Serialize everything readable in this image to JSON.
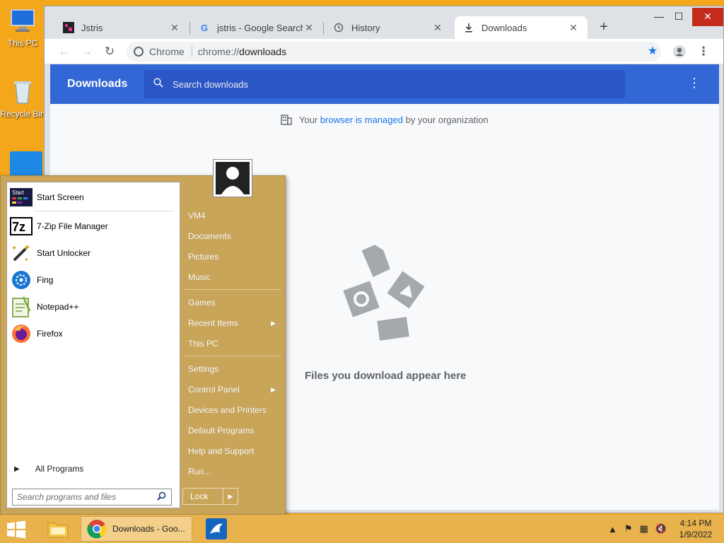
{
  "desktop": {
    "icons": [
      {
        "label": "This PC"
      },
      {
        "label": "Recycle Bin"
      }
    ]
  },
  "browser": {
    "tabs": [
      {
        "title": "Jstris",
        "icon": "jstris-icon"
      },
      {
        "title": "jstris - Google Search",
        "icon": "google-icon"
      },
      {
        "title": "History",
        "icon": "history-icon"
      },
      {
        "title": "Downloads",
        "icon": "download-icon",
        "active": true
      }
    ],
    "omnibox": {
      "chip": "Chrome",
      "url_scheme": "chrome://",
      "url_host": "downloads"
    }
  },
  "downloads_page": {
    "title": "Downloads",
    "search_placeholder": "Search downloads",
    "managed": {
      "prefix": "Your ",
      "link": "browser is managed",
      "suffix": " by your organization"
    },
    "empty_text": "Files you download appear here"
  },
  "start_menu": {
    "pinned": [
      {
        "label": "Start Screen"
      },
      {
        "label": "7-Zip File Manager"
      },
      {
        "label": "Start Unlocker"
      },
      {
        "label": "Fing"
      },
      {
        "label": "Notepad++"
      },
      {
        "label": "Firefox"
      }
    ],
    "all_programs": "All Programs",
    "search_placeholder": "Search programs and files",
    "right_items": [
      {
        "label": "VM4"
      },
      {
        "label": "Documents"
      },
      {
        "label": "Pictures"
      },
      {
        "label": "Music"
      },
      {
        "label": "Games"
      },
      {
        "label": "Recent Items",
        "submenu": true
      },
      {
        "label": "This PC"
      },
      {
        "label": "Settings"
      },
      {
        "label": "Control Panel",
        "submenu": true
      },
      {
        "label": "Devices and Printers"
      },
      {
        "label": "Default Programs"
      },
      {
        "label": "Help and Support"
      },
      {
        "label": "Run..."
      }
    ],
    "lock_label": "Lock"
  },
  "taskbar": {
    "chrome_label": "Downloads - Goo...",
    "clock_time": "4:14 PM",
    "clock_date": "1/9/2022"
  },
  "colors": {
    "accent_blue": "#3367d6",
    "start_menu_bg": "#c9a55a",
    "taskbar_bg": "#e8b24c",
    "desktop_bg": "#f5a71c"
  }
}
